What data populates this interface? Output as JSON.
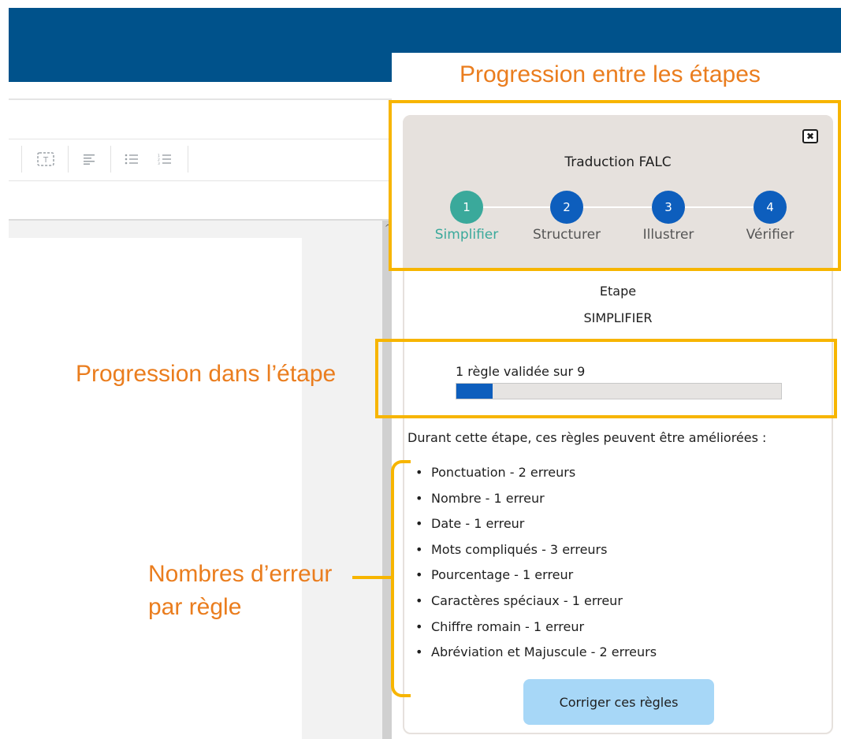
{
  "annotations": {
    "progress_between_steps": "Progression entre les étapes",
    "progress_in_step": "Progression dans l’étape",
    "errors_per_rule_line1": "Nombres d’erreur",
    "errors_per_rule_line2": "par règle",
    "highlight_color": "#f7b500",
    "text_color": "#ea7d1e"
  },
  "toolbar": {
    "icons": [
      "text-box-icon",
      "align-left-icon",
      "bullet-list-icon",
      "numbered-list-icon"
    ]
  },
  "panel": {
    "title": "Traduction FALC",
    "close_icon": "close-icon",
    "steps": [
      {
        "number": "1",
        "label": "Simplifier",
        "active": true,
        "color": "#3aa99b"
      },
      {
        "number": "2",
        "label": "Structurer",
        "active": false,
        "color": "#0d5ebd"
      },
      {
        "number": "3",
        "label": "Illustrer",
        "active": false,
        "color": "#0d5ebd"
      },
      {
        "number": "4",
        "label": "Vérifier",
        "active": false,
        "color": "#0d5ebd"
      }
    ],
    "stage_label": "Etape",
    "stage_name": "SIMPLIFIER",
    "progress_text": "1 règle validée sur 9",
    "progress_fraction": 0.111,
    "rules_intro": "Durant cette étape, ces règles peuvent être améliorées :",
    "rules": [
      "Ponctuation - 2 erreurs",
      "Nombre - 1 erreur",
      "Date - 1 erreur",
      "Mots compliqués - 3 erreurs",
      "Pourcentage - 1 erreur",
      "Caractères spéciaux - 1 erreur",
      "Chiffre romain - 1 erreur",
      "Abréviation et Majuscule - 2 erreurs"
    ],
    "fix_button": "Corriger ces règles"
  },
  "colors": {
    "header": "#00528b",
    "progress_fill": "#0d5ebd",
    "button": "#a7d7f7",
    "active_step": "#3aa99b",
    "inactive_step": "#0d5ebd"
  }
}
